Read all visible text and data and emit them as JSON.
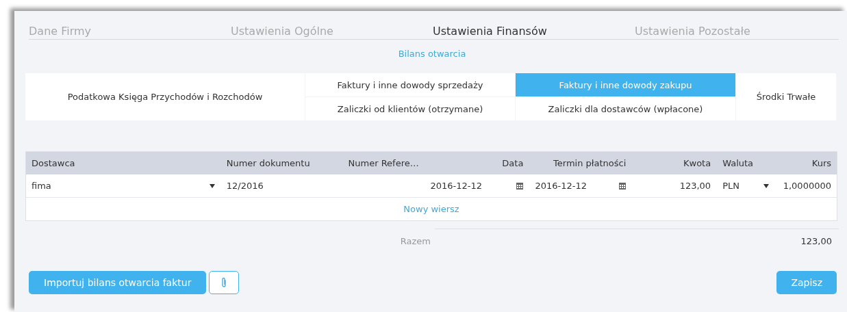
{
  "tabs": [
    {
      "label": "Dane Firmy",
      "selected": false
    },
    {
      "label": "Ustawienia Ogólne",
      "selected": false
    },
    {
      "label": "Ustawienia Finansów",
      "selected": true
    },
    {
      "label": "Ustawienia Pozostałe",
      "selected": false
    }
  ],
  "sub_link": "Bilans otwarcia",
  "categories": [
    {
      "items": [
        {
          "label": "Podatkowa Księga Przychodów i Rozchodów",
          "selected": false
        }
      ]
    },
    {
      "items": [
        {
          "label": "Faktury i inne dowody sprzedaży",
          "selected": false
        },
        {
          "label": "Zaliczki od klientów (otrzymane)",
          "selected": false
        }
      ]
    },
    {
      "items": [
        {
          "label": "Faktury i inne dowody zakupu",
          "selected": true
        },
        {
          "label": "Zaliczki dla dostawców (wpłacone)",
          "selected": false
        }
      ]
    },
    {
      "items": [
        {
          "label": "Środki Trwałe",
          "selected": false
        }
      ]
    }
  ],
  "table": {
    "columns": [
      "Dostawca",
      "Numer dokumentu",
      "Numer Refere…",
      "Data",
      "Termin płatności",
      "Kwota",
      "Waluta",
      "Kurs"
    ],
    "rows": [
      {
        "cells": [
          {
            "kind": "select",
            "value": "fima"
          },
          {
            "kind": "text",
            "value": "12/2016"
          },
          {
            "kind": "empty"
          },
          {
            "kind": "date",
            "value": "2016-12-12"
          },
          {
            "kind": "date",
            "value": "2016-12-12"
          },
          {
            "kind": "number",
            "value": "123,00"
          },
          {
            "kind": "select",
            "value": "PLN"
          },
          {
            "kind": "number",
            "value": "1,0000000"
          }
        ]
      }
    ],
    "new_row": "Nowy wiersz"
  },
  "total": {
    "label": "Razem",
    "value": "123,00"
  },
  "buttons": {
    "import": "Importuj bilans otwarcia faktur",
    "save": "Zapisz"
  }
}
